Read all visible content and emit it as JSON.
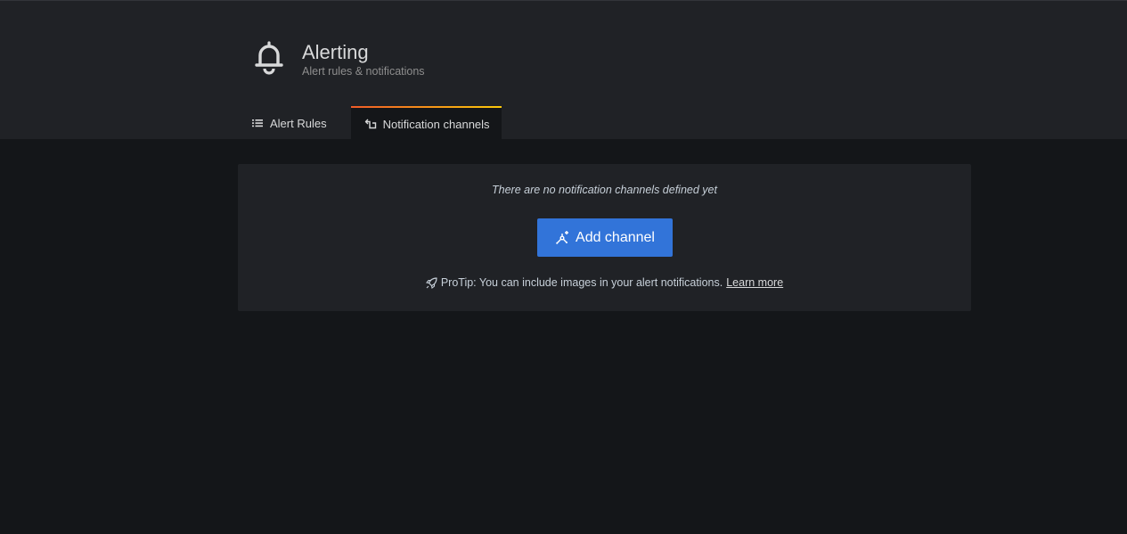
{
  "header": {
    "icon": "bell-icon",
    "title": "Alerting",
    "subtitle": "Alert rules & notifications"
  },
  "tabs": [
    {
      "label": "Alert Rules",
      "icon": "list-icon",
      "active": false
    },
    {
      "label": "Notification channels",
      "icon": "channel-icon",
      "active": true
    }
  ],
  "main": {
    "empty_message": "There are no notification channels defined yet",
    "add_button_label": "Add channel",
    "add_button_icon": "channel-add-icon",
    "protip_icon": "rocket-icon",
    "protip_text": "ProTip: You can include images in your alert notifications.",
    "learn_more_label": "Learn more"
  },
  "colors": {
    "background": "#141619",
    "header_bg": "#202226",
    "panel_bg": "#202226",
    "primary_button": "#3274d9",
    "tab_accent_start": "#f05a28",
    "tab_accent_end": "#fbca0a"
  }
}
